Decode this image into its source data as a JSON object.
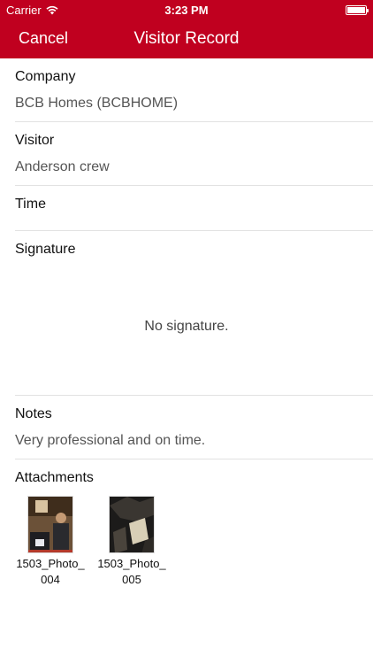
{
  "status": {
    "carrier": "Carrier",
    "time": "3:23 PM"
  },
  "nav": {
    "cancel_label": "Cancel",
    "title": "Visitor Record"
  },
  "fields": {
    "company": {
      "label": "Company",
      "value": "BCB Homes (BCBHOME)"
    },
    "visitor": {
      "label": "Visitor",
      "value": "Anderson crew"
    },
    "time": {
      "label": "Time",
      "value": ""
    },
    "signature": {
      "label": "Signature",
      "empty_text": "No signature."
    },
    "notes": {
      "label": "Notes",
      "value": "Very professional and on time."
    }
  },
  "attachments": {
    "label": "Attachments",
    "items": [
      {
        "name": "1503_Photo_004"
      },
      {
        "name": "1503_Photo_005"
      }
    ]
  },
  "colors": {
    "brand": "#c0001f"
  }
}
